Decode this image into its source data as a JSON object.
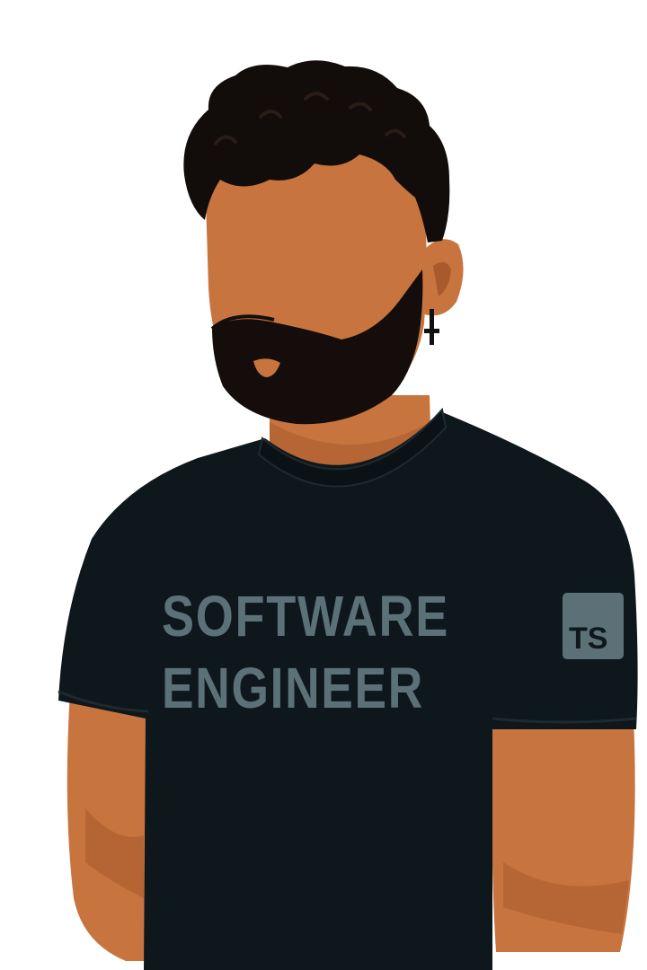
{
  "illustration": {
    "shirt_text": {
      "line1": "SOFTWARE",
      "line2": "ENGINEER"
    },
    "sleeve_badge": {
      "text": "TS",
      "icon": "typescript-logo-icon"
    }
  },
  "colors": {
    "background": "#ffffff",
    "skin": "#c8743f",
    "skin_shadow": "#a85a2c",
    "hair": "#120c0a",
    "beard": "#140d0b",
    "shirt": "#0e171c",
    "shirt_text": "#5c7078",
    "badge_bg": "#5c7078",
    "badge_text": "#0e171c",
    "earring": "#111111"
  }
}
